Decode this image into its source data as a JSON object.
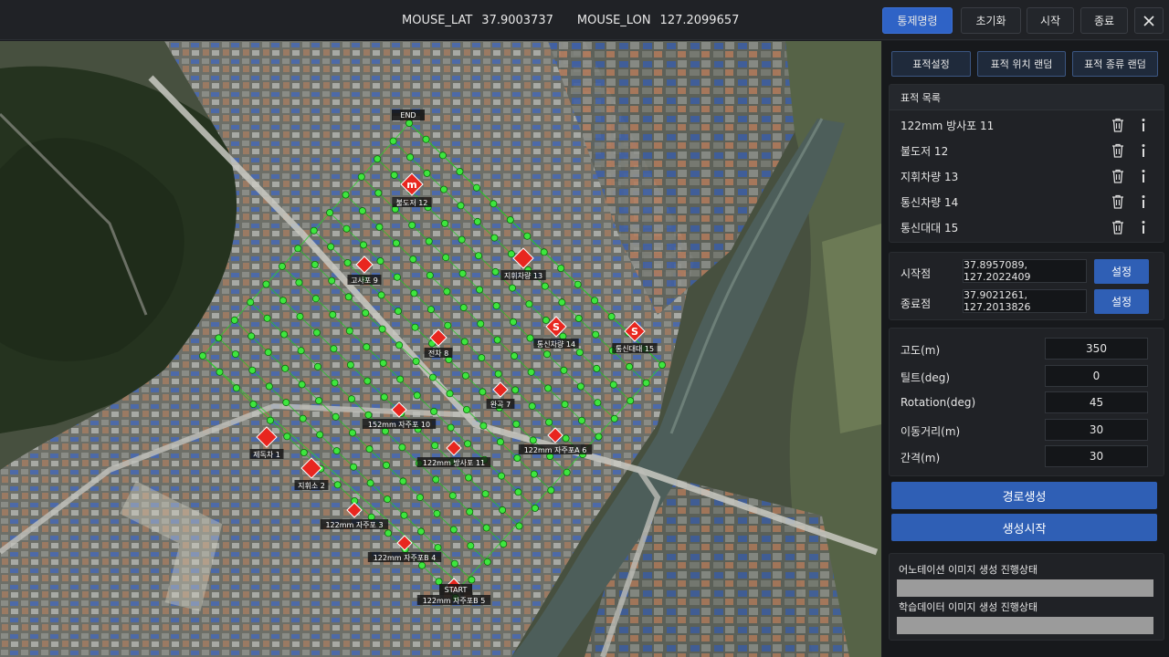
{
  "header": {
    "lat_label": "MOUSE_LAT",
    "lat_value": "37.9003737",
    "lon_label": "MOUSE_LON",
    "lon_value": "127.2099657",
    "buttons": [
      "통제명령",
      "초기화",
      "시작",
      "종료"
    ],
    "close_icon": "close-icon"
  },
  "map": {
    "start_label": "START",
    "end_label": "END",
    "targets": [
      {
        "label": "불도저 12",
        "tag": "m"
      },
      {
        "label": "고사포 9",
        "tag": ""
      },
      {
        "label": "지휘차량 13",
        "tag": ""
      },
      {
        "label": "전차 8",
        "tag": ""
      },
      {
        "label": "통신차량 14",
        "tag": "S"
      },
      {
        "label": "통신대대 15",
        "tag": "S"
      },
      {
        "label": "완곡 7",
        "tag": ""
      },
      {
        "label": "152mm 자주포 10",
        "tag": ""
      },
      {
        "label": "122mm 자주포A 6",
        "tag": ""
      },
      {
        "label": "122mm 방사포 11",
        "tag": ""
      },
      {
        "label": "제독차 1",
        "tag": ""
      },
      {
        "label": "지휘소 2",
        "tag": ""
      },
      {
        "label": "122mm 자주포 3",
        "tag": ""
      },
      {
        "label": "122mm 자주포B 4",
        "tag": ""
      },
      {
        "label": "122mm 자주포B 5",
        "tag": ""
      }
    ]
  },
  "panel": {
    "target_buttons": [
      "표적설정",
      "표적 위치 랜덤",
      "표적 종류 랜덤"
    ],
    "target_list_title": "표적 목록",
    "target_list": [
      "122mm 방사포 11",
      "불도저 12",
      "지휘차량 13",
      "통신차량 14",
      "통신대대 15"
    ],
    "start_label": "시작점",
    "start_value": "37.8957089, 127.2022409",
    "end_label": "종료점",
    "end_value": "37.9021261, 127.2013826",
    "set_label": "설정",
    "params": [
      {
        "label": "고도(m)",
        "value": "350"
      },
      {
        "label": "틸트(deg)",
        "value": "0"
      },
      {
        "label": "Rotation(deg)",
        "value": "45"
      },
      {
        "label": "이동거리(m)",
        "value": "30"
      },
      {
        "label": "간격(m)",
        "value": "30"
      }
    ],
    "route_button": "경로생성",
    "gen_button": "생성시작",
    "annotation_progress_label": "어노테이션 이미지 생성 진행상태",
    "annotation_progress": 0,
    "training_progress_label": "학습데이터 이미지 생성 진행상태",
    "training_progress": 0
  }
}
